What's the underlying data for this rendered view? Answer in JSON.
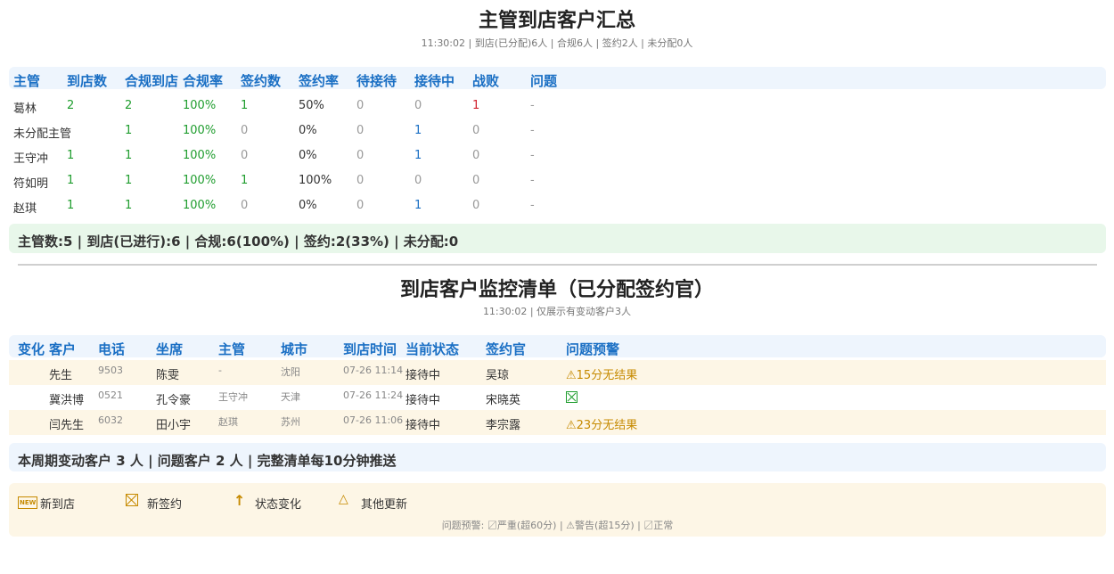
{
  "summary": {
    "title": "主管到店客户汇总",
    "subtitle": "11:30:02 | 到店(已分配)6人 | 合规6人 | 签约2人 | 未分配0人",
    "headers": [
      "主管",
      "到店数",
      "合规到店",
      "合规率",
      "签约数",
      "签约率",
      "待接待",
      "接待中",
      "战败",
      "问题"
    ],
    "rows": [
      [
        "葛林",
        "2",
        "2",
        "100%",
        "1",
        "50%",
        "0",
        "0",
        "1",
        "-"
      ],
      [
        "未分配主管",
        "",
        "1",
        "100%",
        "0",
        "0%",
        "0",
        "1",
        "0",
        "-"
      ],
      [
        "王守冲",
        "1",
        "1",
        "100%",
        "0",
        "0%",
        "0",
        "1",
        "0",
        "-"
      ],
      [
        "符如明",
        "1",
        "1",
        "100%",
        "1",
        "100%",
        "0",
        "0",
        "0",
        "-"
      ],
      [
        "赵琪",
        "1",
        "1",
        "100%",
        "0",
        "0%",
        "0",
        "1",
        "0",
        "-"
      ]
    ],
    "footer": "主管数:5 | 到店(已进行):6 | 合规:6(100%) | 签约:2(33%) | 未分配:0"
  },
  "monitor": {
    "title": "到店客户监控清单（已分配签约官）",
    "subtitle": "11:30:02 | 仅展示有变动客户3人",
    "headers": [
      "变化",
      "客户",
      "电话",
      "坐席",
      "主管",
      "城市",
      "到店时间",
      "当前状态",
      "签约官",
      "问题预警"
    ],
    "rows": [
      {
        "change": "",
        "customer": "先生",
        "phone": "9503",
        "agent": "陈雯",
        "manager": "-",
        "city": "沈阳",
        "time": "07-26 11:14",
        "status": "接待中",
        "officer": "吴琼",
        "alert": "⚠15分无结果",
        "alert_type": "warning"
      },
      {
        "change": "",
        "customer": "冀洪博",
        "phone": "0521",
        "agent": "孔令豪",
        "manager": "王守冲",
        "city": "天津",
        "time": "07-26 11:24",
        "status": "接待中",
        "officer": "宋晓英",
        "alert": "",
        "alert_type": "normal"
      },
      {
        "change": "",
        "customer": "闫先生",
        "phone": "6032",
        "agent": "田小宇",
        "manager": "赵琪",
        "city": "苏州",
        "time": "07-26 11:06",
        "status": "接待中",
        "officer": "李宗露",
        "alert": "⚠23分无结果",
        "alert_type": "warning"
      }
    ],
    "footer": "本周期变动客户 3 人 | 问题客户 2 人 | 完整清单每10分钟推送"
  },
  "legend": {
    "items": [
      {
        "icon": "new-icon",
        "label": "新到店"
      },
      {
        "icon": "new-sign-icon",
        "label": "新签约"
      },
      {
        "icon": "arrow-up-icon",
        "label": "状态变化"
      },
      {
        "icon": "triangle-icon",
        "label": "其他更新"
      }
    ],
    "note": "问题预警: 〼严重(超60分) | ⚠警告(超15分) | 〼正常"
  },
  "colors": {
    "accent": "#1a6fc4",
    "success": "#1f9d2e",
    "danger": "#d0202c",
    "warning": "#c68a00",
    "header_bg": "#eef5fd",
    "summary_bg": "#e8f7ea",
    "highlight_bg": "#fdf6e6"
  }
}
